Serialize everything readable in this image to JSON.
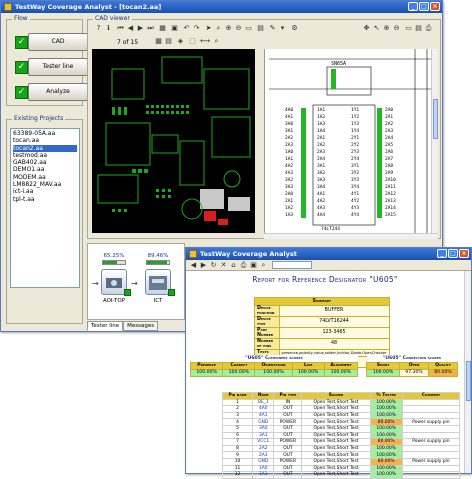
{
  "main_window": {
    "title": "TestWay Coverage Analyst - [tocan2.aa]",
    "flow_label": "Flow",
    "flow_buttons": [
      "CAD",
      "Tester line",
      "Analyze"
    ],
    "projects_label": "Existing Projects",
    "projects": [
      "63389-05A.aa",
      "tocan.aa",
      "tocan2.aa",
      "testmod.aa",
      "GAB402.aa",
      "DEMO1.aa",
      "MODEM.aa",
      "LM8822_MAV.aa",
      "ict-i.aa",
      "tpl-t.aa"
    ],
    "selected_project": "tocan2.aa",
    "cad_viewer_label": "CAD viewer",
    "page_indicator": "7 of 15",
    "tabs": [
      "Tester line",
      "Messages"
    ],
    "tester_nodes": [
      {
        "label": "AOI-TOP",
        "percent": "65.25%",
        "progress": 0.65
      },
      {
        "label": "ICT",
        "percent": "89.46%",
        "progress": 0.89
      }
    ],
    "chip": {
      "name": "SN65A",
      "part": "74LT244"
    }
  },
  "report_window": {
    "title": "TestWay Coverage Analyst",
    "report_title": "Report for Reference Designator \"U605\"",
    "summary": {
      "header": "Summary",
      "rows": [
        {
          "key": "Device function",
          "value": "BUFFER"
        },
        {
          "key": "Device type",
          "value": "74LVT16244"
        },
        {
          "key": "Part Number",
          "value": "123-3465"
        },
        {
          "key": "Number of pins",
          "value": "48"
        },
        {
          "key": "Tests",
          "value": "presence,polarity,value,solder,Incktor,Diode,OpenChecker"
        },
        {
          "key": "Coverage score",
          "value": "97.74%"
        }
      ]
    },
    "component_scores": {
      "title": "\"U605\" Component scores",
      "headers": [
        "Presence",
        "Correct",
        "Orientation",
        "Live",
        "Alignment"
      ],
      "values": [
        "100.00%",
        "100.00%",
        "100.00%",
        "100.00%",
        "100.00%"
      ]
    },
    "connection_scores": {
      "title": "\"U605\" Connection scores",
      "headers": [
        "Short",
        "Open",
        "Quality"
      ],
      "values": [
        "100.00%",
        "97.30%",
        "80.00%"
      ]
    },
    "pins_headers": [
      "Pin name",
      "Node",
      "Pin type",
      "Solder",
      "% Tested",
      "Comment"
    ],
    "pins": [
      {
        "pin": "1",
        "node": "OE_1",
        "type": "IN",
        "solder": "Open Test,Short Test",
        "tested": "100.00%",
        "comment": ""
      },
      {
        "pin": "2",
        "node": "4A0",
        "type": "OUT",
        "solder": "Open Test,Short Test",
        "tested": "100.00%",
        "comment": ""
      },
      {
        "pin": "3",
        "node": "4A1",
        "type": "OUT",
        "solder": "Open Test,Short Test",
        "tested": "100.00%",
        "comment": ""
      },
      {
        "pin": "4",
        "node": "GND",
        "type": "POWER",
        "solder": "Open Test,Short Test",
        "tested": "80.00%",
        "comment": "Power supply pin"
      },
      {
        "pin": "5",
        "node": "3A0",
        "type": "OUT",
        "solder": "Open Test,Short Test",
        "tested": "100.00%",
        "comment": ""
      },
      {
        "pin": "6",
        "node": "3A1",
        "type": "OUT",
        "solder": "Open Test,Short Test",
        "tested": "100.00%",
        "comment": ""
      },
      {
        "pin": "7",
        "node": "VCC1",
        "type": "POWER",
        "solder": "Open Test,Short Test",
        "tested": "80.00%",
        "comment": "Power supply pin"
      },
      {
        "pin": "8",
        "node": "2A2",
        "type": "OUT",
        "solder": "Open Test,Short Test",
        "tested": "100.00%",
        "comment": ""
      },
      {
        "pin": "9",
        "node": "2A3",
        "type": "OUT",
        "solder": "Open Test,Short Test",
        "tested": "100.00%",
        "comment": ""
      },
      {
        "pin": "10",
        "node": "GND",
        "type": "POWER",
        "solder": "Open Test,Short Test",
        "tested": "80.00%",
        "comment": "Power supply pin"
      },
      {
        "pin": "11",
        "node": "1A0",
        "type": "OUT",
        "solder": "Open Test,Short Test",
        "tested": "100.00%",
        "comment": ""
      },
      {
        "pin": "12",
        "node": "1A1",
        "type": "OUT",
        "solder": "Open Test,Short Test",
        "tested": "100.00%",
        "comment": ""
      }
    ]
  }
}
